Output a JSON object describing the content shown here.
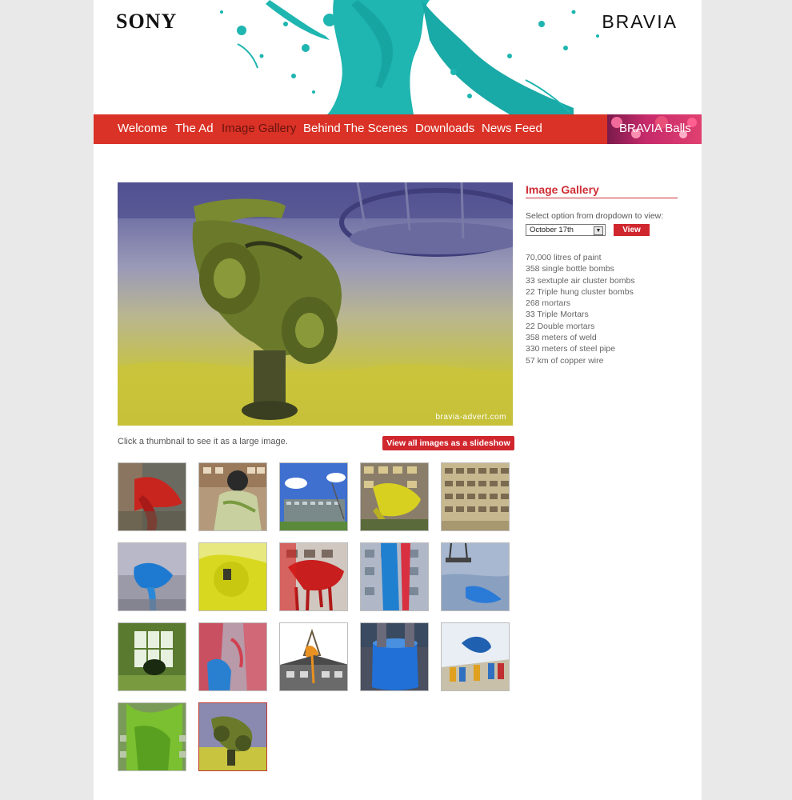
{
  "brand": {
    "sony": "SONY",
    "bravia": "BRAVIA"
  },
  "nav": {
    "items": [
      "Welcome",
      "The Ad",
      "Image Gallery",
      "Behind The Scenes",
      "Downloads",
      "News Feed"
    ],
    "active": "Image Gallery",
    "promo": "BRAVIA Balls"
  },
  "gallery": {
    "watermark": "bravia-advert.com",
    "hint": "Click a thumbnail to see it as a large image.",
    "slideshow_label": "View all images as a slideshow",
    "selected_index": 16,
    "thumbnail_count": 17
  },
  "sidebar": {
    "title": "Image Gallery",
    "select_label": "Select option from dropdown to view:",
    "select_value": "October 17th",
    "view_label": "View",
    "stats": [
      "70,000 litres of paint",
      "358 single bottle bombs",
      "33 sextuple air cluster bombs",
      "22 Triple hung cluster bombs",
      "268 mortars",
      "33 Triple Mortars",
      "22 Double mortars",
      "358 meters of weld",
      "330 meters of steel pipe",
      "57 km of copper wire"
    ]
  },
  "colors": {
    "brand_red": "#da3226",
    "accent_red": "#cf2e36",
    "teal_paint": "#1fb5b0"
  }
}
